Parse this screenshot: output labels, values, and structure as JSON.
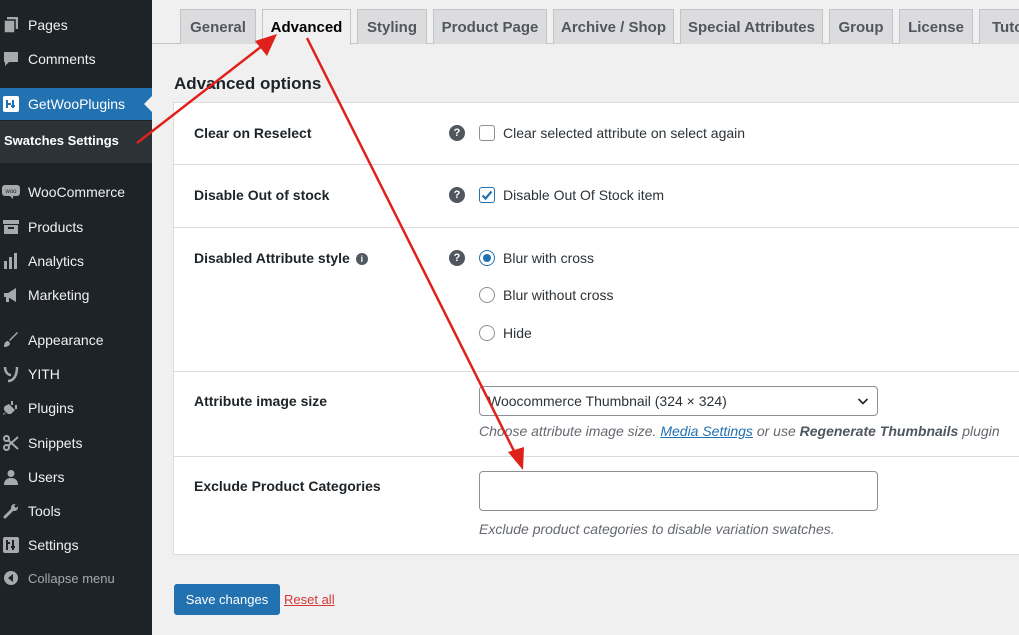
{
  "sidebar": {
    "items": [
      {
        "label": "Pages",
        "icon": "pages-icon"
      },
      {
        "label": "Comments",
        "icon": "comments-icon"
      },
      {
        "label": "GetWooPlugins",
        "icon": "getwooplugins-icon"
      },
      {
        "label": "WooCommerce",
        "icon": "woocommerce-icon"
      },
      {
        "label": "Products",
        "icon": "products-icon"
      },
      {
        "label": "Analytics",
        "icon": "analytics-icon"
      },
      {
        "label": "Marketing",
        "icon": "marketing-icon"
      },
      {
        "label": "Appearance",
        "icon": "appearance-icon"
      },
      {
        "label": "YITH",
        "icon": "yith-icon"
      },
      {
        "label": "Plugins",
        "icon": "plugins-icon"
      },
      {
        "label": "Snippets",
        "icon": "snippets-icon"
      },
      {
        "label": "Users",
        "icon": "users-icon"
      },
      {
        "label": "Tools",
        "icon": "tools-icon"
      },
      {
        "label": "Settings",
        "icon": "settings-icon"
      }
    ],
    "submenu_label": "Swatches Settings",
    "collapse_label": "Collapse menu"
  },
  "tabs": [
    "General",
    "Advanced",
    "Styling",
    "Product Page",
    "Archive / Shop",
    "Special Attributes",
    "Group",
    "License",
    "Tuto"
  ],
  "active_tab": "Advanced",
  "page_heading": "Advanced options",
  "settings": {
    "clear_on_reselect": {
      "label": "Clear on Reselect",
      "option": "Clear selected attribute on select again",
      "checked": false
    },
    "disable_out_of_stock": {
      "label": "Disable Out of stock",
      "option": "Disable Out Of Stock item",
      "checked": true
    },
    "disabled_attribute_style": {
      "label": "Disabled Attribute style",
      "options": [
        "Blur with cross",
        "Blur without cross",
        "Hide"
      ],
      "selected": "Blur with cross"
    },
    "attribute_image_size": {
      "label": "Attribute image size",
      "value": "Woocommerce Thumbnail (324 × 324)",
      "desc_pre": "Choose attribute image size. ",
      "desc_link": "Media Settings",
      "desc_mid": " or use ",
      "desc_bold": "Regenerate Thumbnails",
      "desc_post": " plugin"
    },
    "exclude_categories": {
      "label": "Exclude Product Categories",
      "value": "",
      "desc": "Exclude product categories to disable variation swatches."
    }
  },
  "buttons": {
    "save": "Save changes",
    "reset": "Reset all"
  },
  "colors": {
    "accent": "#2271b1",
    "sidebar": "#1d2327",
    "annotation_arrow": "#e0201b",
    "reset": "#d63638"
  }
}
